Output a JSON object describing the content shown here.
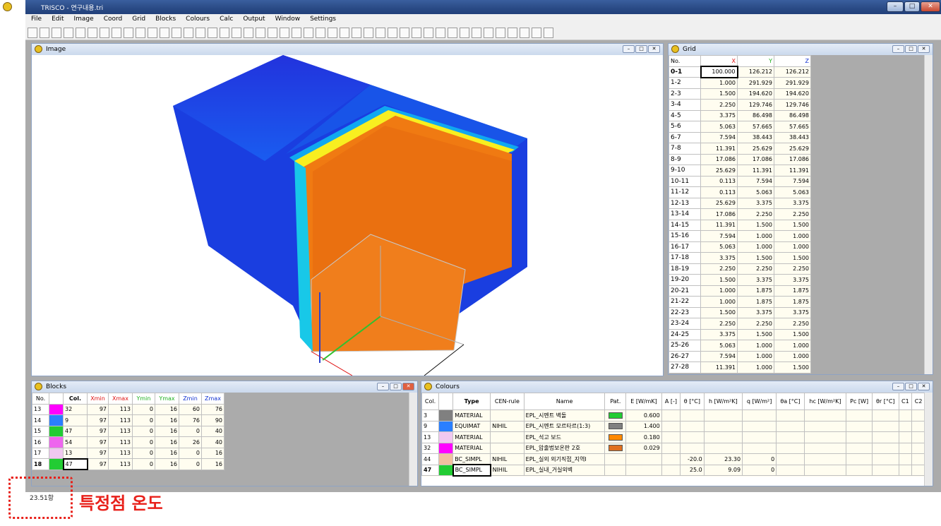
{
  "window": {
    "title": "TRISCO - 연구내용.tri"
  },
  "menu": [
    "File",
    "Edit",
    "Image",
    "Coord",
    "Grid",
    "Blocks",
    "Colours",
    "Calc",
    "Output",
    "Window",
    "Settings"
  ],
  "image_panel": {
    "title": "Image"
  },
  "grid_panel": {
    "title": "Grid",
    "headers": [
      "No.",
      "X",
      "Y",
      "Z"
    ],
    "rows": [
      [
        "0-1",
        "100.000",
        "126.212",
        "126.212"
      ],
      [
        "1-2",
        "1.000",
        "291.929",
        "291.929"
      ],
      [
        "2-3",
        "1.500",
        "194.620",
        "194.620"
      ],
      [
        "3-4",
        "2.250",
        "129.746",
        "129.746"
      ],
      [
        "4-5",
        "3.375",
        "86.498",
        "86.498"
      ],
      [
        "5-6",
        "5.063",
        "57.665",
        "57.665"
      ],
      [
        "6-7",
        "7.594",
        "38.443",
        "38.443"
      ],
      [
        "7-8",
        "11.391",
        "25.629",
        "25.629"
      ],
      [
        "8-9",
        "17.086",
        "17.086",
        "17.086"
      ],
      [
        "9-10",
        "25.629",
        "11.391",
        "11.391"
      ],
      [
        "10-11",
        "0.113",
        "7.594",
        "7.594"
      ],
      [
        "11-12",
        "0.113",
        "5.063",
        "5.063"
      ],
      [
        "12-13",
        "25.629",
        "3.375",
        "3.375"
      ],
      [
        "13-14",
        "17.086",
        "2.250",
        "2.250"
      ],
      [
        "14-15",
        "11.391",
        "1.500",
        "1.500"
      ],
      [
        "15-16",
        "7.594",
        "1.000",
        "1.000"
      ],
      [
        "16-17",
        "5.063",
        "1.000",
        "1.000"
      ],
      [
        "17-18",
        "3.375",
        "1.500",
        "1.500"
      ],
      [
        "18-19",
        "2.250",
        "2.250",
        "2.250"
      ],
      [
        "19-20",
        "1.500",
        "3.375",
        "3.375"
      ],
      [
        "20-21",
        "1.000",
        "1.875",
        "1.875"
      ],
      [
        "21-22",
        "1.000",
        "1.875",
        "1.875"
      ],
      [
        "22-23",
        "1.500",
        "3.375",
        "3.375"
      ],
      [
        "23-24",
        "2.250",
        "2.250",
        "2.250"
      ],
      [
        "24-25",
        "3.375",
        "1.500",
        "1.500"
      ],
      [
        "25-26",
        "5.063",
        "1.000",
        "1.000"
      ],
      [
        "26-27",
        "7.594",
        "1.000",
        "1.000"
      ],
      [
        "27-28",
        "11.391",
        "1.000",
        "1.500"
      ]
    ]
  },
  "blocks_panel": {
    "title": "Blocks",
    "headers": [
      "No.",
      "",
      "Col.",
      "Xmin",
      "Xmax",
      "Ymin",
      "Ymax",
      "Zmin",
      "Zmax"
    ],
    "rows": [
      {
        "no": "13",
        "color": "#ff00ff",
        "vals": [
          "32",
          "97",
          "113",
          "0",
          "16",
          "60",
          "76"
        ]
      },
      {
        "no": "14",
        "color": "#2a7fff",
        "vals": [
          "9",
          "97",
          "113",
          "0",
          "16",
          "76",
          "90"
        ]
      },
      {
        "no": "15",
        "color": "#22cc33",
        "vals": [
          "47",
          "97",
          "113",
          "0",
          "16",
          "0",
          "40"
        ]
      },
      {
        "no": "16",
        "color": "#ee66ee",
        "vals": [
          "54",
          "97",
          "113",
          "0",
          "16",
          "26",
          "40"
        ]
      },
      {
        "no": "17",
        "color": "#f0c8f0",
        "vals": [
          "13",
          "97",
          "113",
          "0",
          "16",
          "0",
          "16"
        ]
      },
      {
        "no": "18",
        "color": "#22cc33",
        "vals": [
          "47",
          "97",
          "113",
          "0",
          "16",
          "0",
          "16"
        ]
      }
    ]
  },
  "colours_panel": {
    "title": "Colours",
    "headers": [
      "Col.",
      "",
      "Type",
      "CEN-rule",
      "Name",
      "Pat.",
      "E [W/mK]",
      "A [-]",
      "θ [°C]",
      "h [W/m²K]",
      "q [W/m²]",
      "θa [°C]",
      "hc [W/m²K]",
      "Pc [W]",
      "θr [°C]",
      "C1",
      "C2"
    ],
    "rows": [
      {
        "col": "3",
        "color": "#808080",
        "type": "MATERIAL",
        "cen": "",
        "name": "EPL_시멘트 벽돌",
        "pat": "#22cc33",
        "E": "0.600",
        "theta": "",
        "h": "",
        "q": ""
      },
      {
        "col": "9",
        "color": "#2a7fff",
        "type": "EQUIMAT",
        "cen": "NIHIL",
        "name": "EPL_시멘트 모르타르(1:3)",
        "pat": "#808080",
        "E": "1.400",
        "theta": "",
        "h": "",
        "q": ""
      },
      {
        "col": "13",
        "color": "#f0c8f0",
        "type": "MATERIAL",
        "cen": "",
        "name": "EPL_석고 보드",
        "pat": "#ff8800",
        "E": "0.180",
        "theta": "",
        "h": "",
        "q": ""
      },
      {
        "col": "32",
        "color": "#ff00ff",
        "type": "MATERIAL",
        "cen": "",
        "name": "EPL_압출법보온판 2호",
        "pat": "#e07020",
        "E": "0.029",
        "theta": "",
        "h": "",
        "q": ""
      },
      {
        "col": "44",
        "color": "#f2c0a0",
        "type": "BC_SIMPL",
        "cen": "NIHIL",
        "name": "EPL_실외 외기직접_지역Ⅰ",
        "pat": "",
        "E": "",
        "theta": "-20.0",
        "h": "23.30",
        "q": "0"
      },
      {
        "col": "47",
        "color": "#22cc33",
        "type": "BC_SIMPL",
        "cen": "NIHIL",
        "name": "EPL_실내_거실외벽",
        "pat": "",
        "E": "",
        "theta": "25.0",
        "h": "9.09",
        "q": "0"
      }
    ]
  },
  "status": {
    "text": "23.51항"
  },
  "annotation": {
    "label": "특정점 온도"
  }
}
